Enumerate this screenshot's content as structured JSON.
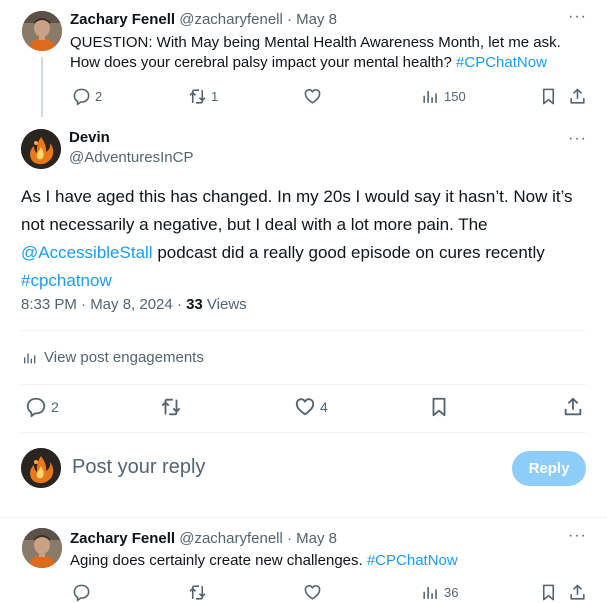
{
  "tweet1": {
    "name": "Zachary Fenell",
    "handle": "@zacharyfenell",
    "date": "· May 8",
    "text": "QUESTION: With May being Mental Health Awareness Month, let me ask.",
    "text2_plain": "How does your cerebral palsy impact your mental health? ",
    "hashtag": "#CPChatNow",
    "replies": "2",
    "reposts": "1",
    "views": "150"
  },
  "main": {
    "name": "Devin",
    "handle": "@AdventuresInCP",
    "line1": "As I have aged this has changed. In my 20s I would say it hasn’t. Now it’s",
    "line2": "not necessarily a negative, but I deal with a lot more pain. The",
    "mention": "@AccessibleStall",
    "line3_rest": " podcast did a really good episode on cures recently",
    "hashtag": "#cpchatnow",
    "timestamp": "8:33 PM · May 8, 2024 · ",
    "views_count": "33",
    "views_label": " Views",
    "engagements": "View post engagements",
    "replies": "2",
    "likes": "4"
  },
  "reply_box": {
    "placeholder": "Post your reply",
    "button": "Reply"
  },
  "tweet3": {
    "name": "Zachary Fenell",
    "handle": "@zacharyfenell",
    "date": "· May 8",
    "text_plain": "Aging does certainly create new challenges. ",
    "hashtag": "#CPChatNow",
    "views": "36"
  },
  "icons": [
    "more-icon",
    "reply-icon",
    "repost-icon",
    "like-icon",
    "views-icon",
    "bookmark-icon",
    "share-icon"
  ],
  "colors": {
    "link": "#1d9bf0",
    "muted": "#536471",
    "reply_button": "#8ecdf8",
    "divider": "#eff3f4"
  }
}
